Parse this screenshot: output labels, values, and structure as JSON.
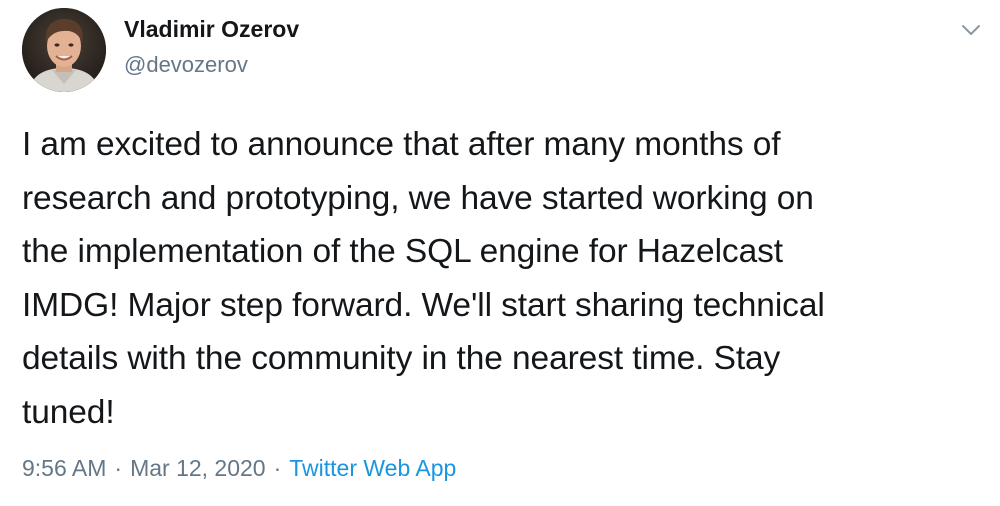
{
  "author": {
    "name": "Vladimir Ozerov",
    "handle": "@devozerov"
  },
  "tweet": {
    "lines": [
      "I am excited to announce that after many months of",
      "research and prototyping, we have started working on",
      "the implementation of the SQL engine for Hazelcast",
      "IMDG! Major step forward. We'll start sharing technical",
      "details with the community in the nearest time. Stay",
      "tuned!"
    ]
  },
  "meta": {
    "time": "9:56 AM",
    "separator": "·",
    "date": "Mar 12, 2020",
    "source": "Twitter Web App"
  },
  "icons": {
    "menu": "chevron-down-icon"
  },
  "colors": {
    "text": "#14171a",
    "secondary": "#657786",
    "link": "#1b95e0"
  }
}
